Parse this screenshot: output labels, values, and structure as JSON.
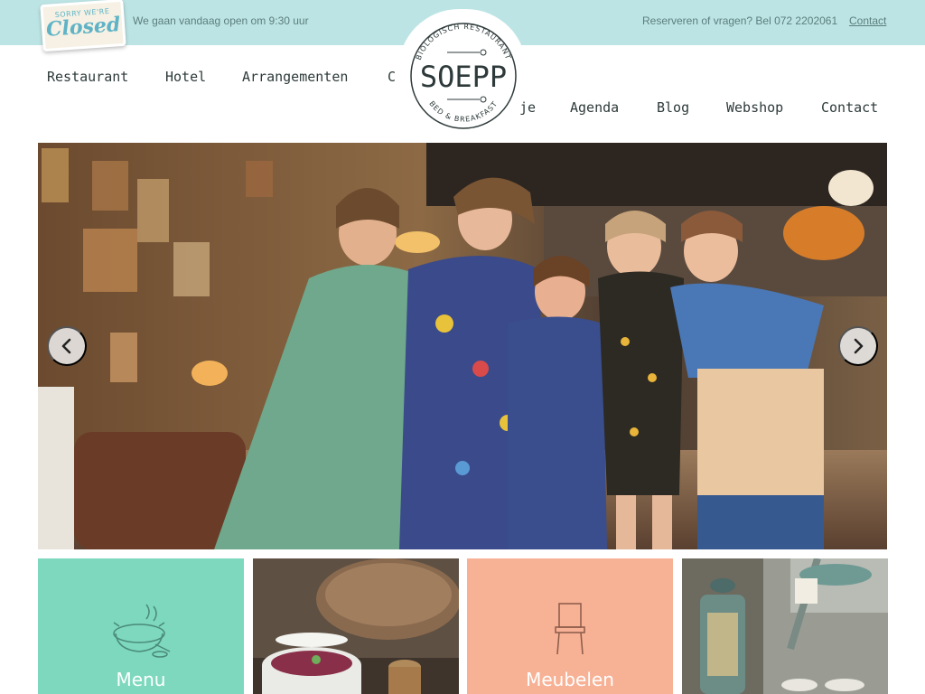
{
  "topbar": {
    "closed_badge_top": "SORRY WE'RE",
    "closed_badge_main": "Closed",
    "open_message": "We gaan vandaag open om 9:30 uur",
    "reserve_text": "Reserveren of vragen? Bel 072 2202061",
    "contact_link": "Contact"
  },
  "logo": {
    "arc_top": "BIOLOGISCH RESTAURANT",
    "name": "SOEPP",
    "arc_bottom": "BED & BREAKFAST"
  },
  "nav": {
    "left": [
      "Restaurant",
      "Hotel",
      "Arrangementen",
      "C"
    ],
    "right": [
      "je",
      "Agenda",
      "Blog",
      "Webshop",
      "Contact"
    ]
  },
  "hero": {
    "prev_icon": "chevron-left-icon",
    "next_icon": "chevron-right-icon"
  },
  "tiles": [
    {
      "label": "Menu",
      "icon": "soup-pot-icon",
      "color": "#7dd8bd"
    },
    {
      "label": "",
      "icon": "photo-soup-bowl",
      "color": "#6f5c4d"
    },
    {
      "label": "Meubelen",
      "icon": "chair-icon",
      "color": "#f7b195"
    },
    {
      "label": "",
      "icon": "photo-lantern",
      "color": "#8a8f88"
    }
  ],
  "colors": {
    "topbar": "#bde4e4",
    "mint": "#7dd8bd",
    "peach": "#f7b195",
    "text_dark": "#2e3a3a"
  }
}
